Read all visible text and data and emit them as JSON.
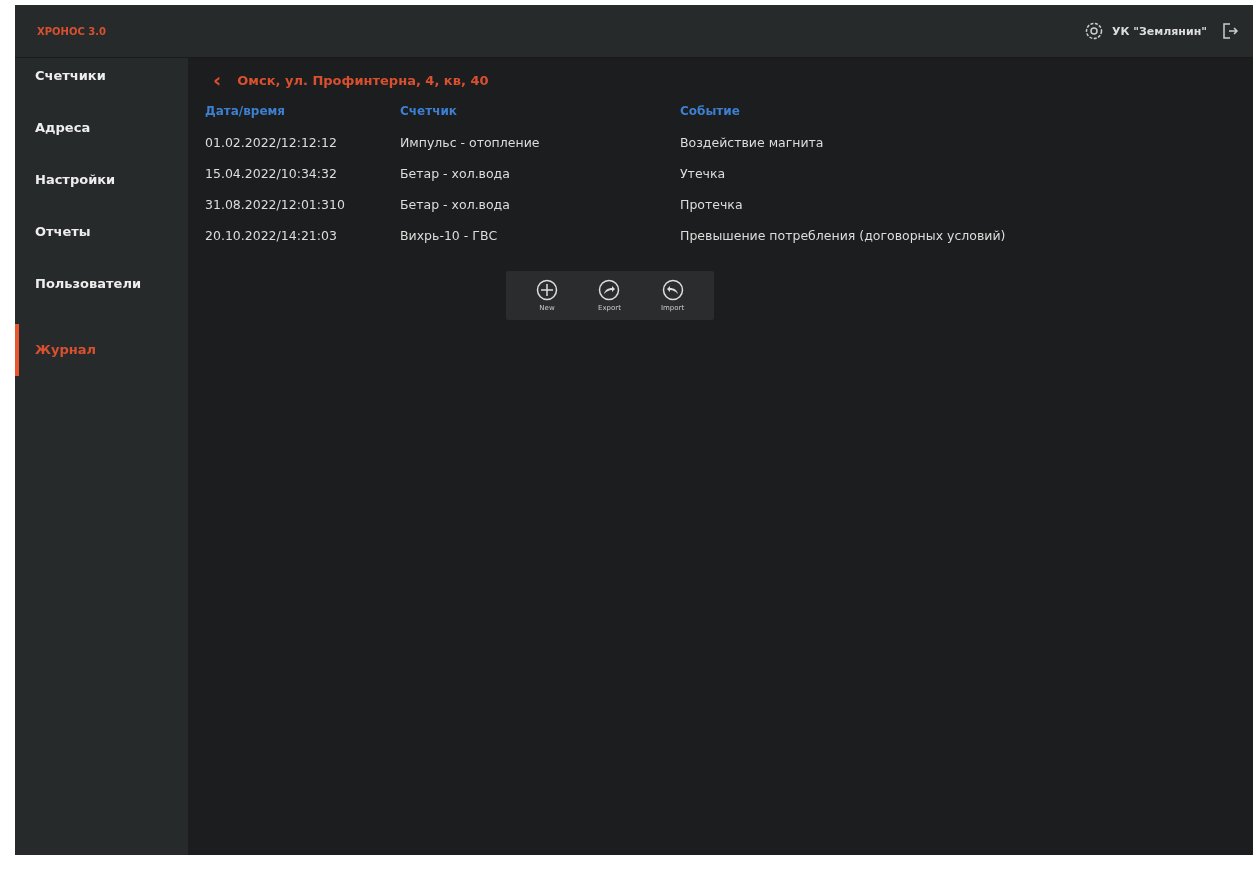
{
  "header": {
    "logo": "ХРОНОС 3.0",
    "organization": "УК \"Землянин\""
  },
  "sidebar": {
    "items": [
      {
        "label": "Счетчики",
        "selected": false
      },
      {
        "label": "Адреса",
        "selected": false
      },
      {
        "label": "Настройки",
        "selected": false
      },
      {
        "label": "Отчеты",
        "selected": false
      },
      {
        "label": "Пользователи",
        "selected": false
      },
      {
        "label": "Журнал",
        "selected": true
      }
    ]
  },
  "breadcrumb": {
    "back": "‹",
    "address": "Омск, ул. Профинтерна, 4, кв, 40"
  },
  "table": {
    "columns": [
      "Дата/время",
      "Счетчик",
      "Событие"
    ],
    "rows": [
      [
        "01.02.2022/12:12:12",
        "Импульс - отопление",
        "Воздействие магнита"
      ],
      [
        "15.04.2022/10:34:32",
        "Бетар - хол.вода",
        "Утечка"
      ],
      [
        "31.08.2022/12:01:310",
        "Бетар - хол.вода",
        "Протечка"
      ],
      [
        "20.10.2022/14:21:03",
        "Вихрь-10 - ГВС",
        "Превышение потребления  (договорных условий)"
      ]
    ]
  },
  "toolbar": [
    {
      "kind": "new",
      "label": "New"
    },
    {
      "kind": "export",
      "label": "Export"
    },
    {
      "kind": "import",
      "label": "Import"
    }
  ]
}
